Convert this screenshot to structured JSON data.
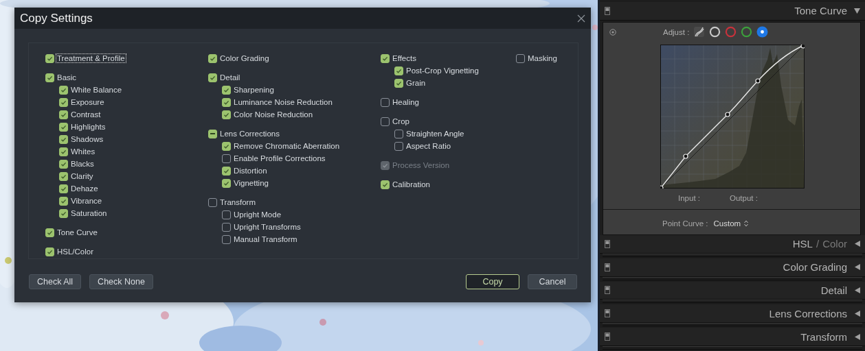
{
  "dialog": {
    "title": "Copy Settings",
    "columns": [
      {
        "groups": [
          {
            "label": "Treatment & Profile",
            "checked": true,
            "disabled": false,
            "focused": true
          },
          {
            "label": "Basic",
            "checked": true,
            "disabled": false,
            "focused": false,
            "children": [
              {
                "label": "White Balance",
                "checked": true,
                "disabled": false,
                "focused": false
              },
              {
                "label": "Exposure",
                "checked": true,
                "disabled": false,
                "focused": false
              },
              {
                "label": "Contrast",
                "checked": true,
                "disabled": false,
                "focused": false
              },
              {
                "label": "Highlights",
                "checked": true,
                "disabled": false,
                "focused": false
              },
              {
                "label": "Shadows",
                "checked": true,
                "disabled": false,
                "focused": false
              },
              {
                "label": "Whites",
                "checked": true,
                "disabled": false,
                "focused": false
              },
              {
                "label": "Blacks",
                "checked": true,
                "disabled": false,
                "focused": false
              },
              {
                "label": "Clarity",
                "checked": true,
                "disabled": false,
                "focused": false
              },
              {
                "label": "Dehaze",
                "checked": true,
                "disabled": false,
                "focused": false
              },
              {
                "label": "Vibrance",
                "checked": true,
                "disabled": false,
                "focused": false
              },
              {
                "label": "Saturation",
                "checked": true,
                "disabled": false,
                "focused": false
              }
            ]
          },
          {
            "label": "Tone Curve",
            "checked": true,
            "disabled": false,
            "focused": false
          },
          {
            "label": "HSL/Color",
            "checked": true,
            "disabled": false,
            "focused": false
          }
        ]
      },
      {
        "groups": [
          {
            "label": "Color Grading",
            "checked": true,
            "disabled": false,
            "focused": false
          },
          {
            "label": "Detail",
            "checked": true,
            "disabled": false,
            "focused": false,
            "children": [
              {
                "label": "Sharpening",
                "checked": true,
                "disabled": false,
                "focused": false
              },
              {
                "label": "Luminance Noise Reduction",
                "checked": true,
                "disabled": false,
                "focused": false
              },
              {
                "label": "Color Noise Reduction",
                "checked": true,
                "disabled": false,
                "focused": false
              }
            ]
          },
          {
            "label": "Lens Corrections",
            "checked": true,
            "mixed": true,
            "disabled": false,
            "focused": false,
            "children": [
              {
                "label": "Remove Chromatic Aberration",
                "checked": true,
                "disabled": false,
                "focused": false
              },
              {
                "label": "Enable Profile Corrections",
                "checked": false,
                "disabled": false,
                "focused": false
              },
              {
                "label": "Distortion",
                "checked": true,
                "disabled": false,
                "focused": false
              },
              {
                "label": "Vignetting",
                "checked": true,
                "disabled": false,
                "focused": false
              }
            ]
          },
          {
            "label": "Transform",
            "checked": false,
            "disabled": false,
            "focused": false,
            "children": [
              {
                "label": "Upright Mode",
                "checked": false,
                "disabled": false,
                "focused": false
              },
              {
                "label": "Upright Transforms",
                "checked": false,
                "disabled": false,
                "focused": false
              },
              {
                "label": "Manual Transform",
                "checked": false,
                "disabled": false,
                "focused": false
              }
            ]
          }
        ]
      },
      {
        "groups": [
          {
            "label": "Effects",
            "checked": true,
            "disabled": false,
            "focused": false,
            "children": [
              {
                "label": "Post-Crop Vignetting",
                "checked": true,
                "disabled": false,
                "focused": false
              },
              {
                "label": "Grain",
                "checked": true,
                "disabled": false,
                "focused": false
              }
            ]
          },
          {
            "label": "Healing",
            "checked": false,
            "disabled": false,
            "focused": false
          },
          {
            "label": "Crop",
            "checked": false,
            "disabled": false,
            "focused": false,
            "children": [
              {
                "label": "Straighten Angle",
                "checked": false,
                "disabled": false,
                "focused": false
              },
              {
                "label": "Aspect Ratio",
                "checked": false,
                "disabled": false,
                "focused": false
              }
            ]
          },
          {
            "label": "Process Version",
            "checked": true,
            "disabled": true,
            "focused": false
          },
          {
            "label": "Calibration",
            "checked": true,
            "disabled": false,
            "focused": false
          }
        ]
      },
      {
        "groups": [
          {
            "label": "Masking",
            "checked": false,
            "disabled": false,
            "focused": false
          }
        ]
      }
    ],
    "left_buttons": [
      {
        "label": "Check All",
        "default": false
      },
      {
        "label": "Check None",
        "default": false
      }
    ],
    "right_buttons": [
      {
        "label": "Copy",
        "default": true
      },
      {
        "label": "Cancel",
        "default": false
      }
    ]
  },
  "right_panel": {
    "tone_curve": {
      "title": "Tone Curve",
      "expanded": true,
      "adjust_label": "Adjust :",
      "channels": [
        {
          "kind": "parametric",
          "selected": false
        },
        {
          "kind": "circle",
          "color": "#c8c8c8",
          "selected": false
        },
        {
          "kind": "circle",
          "color": "#c8323c",
          "selected": false
        },
        {
          "kind": "circle",
          "color": "#3ca03c",
          "selected": false
        },
        {
          "kind": "circle",
          "color": "#1e78e6",
          "selected": true
        }
      ],
      "input_label": "Input :",
      "output_label": "Output :",
      "point_curve_label": "Point Curve :",
      "point_curve_value": "Custom"
    },
    "sections": [
      {
        "kind": "tabbed",
        "tabs": [
          {
            "label": "HSL",
            "selected": true
          },
          {
            "label": "Color",
            "selected": false
          }
        ],
        "separator": "/",
        "expanded": false
      },
      {
        "kind": "plain",
        "title": "Color Grading",
        "expanded": false
      },
      {
        "kind": "plain",
        "title": "Detail",
        "expanded": false
      },
      {
        "kind": "plain",
        "title": "Lens Corrections",
        "expanded": false
      },
      {
        "kind": "plain",
        "title": "Transform",
        "expanded": false
      }
    ]
  }
}
